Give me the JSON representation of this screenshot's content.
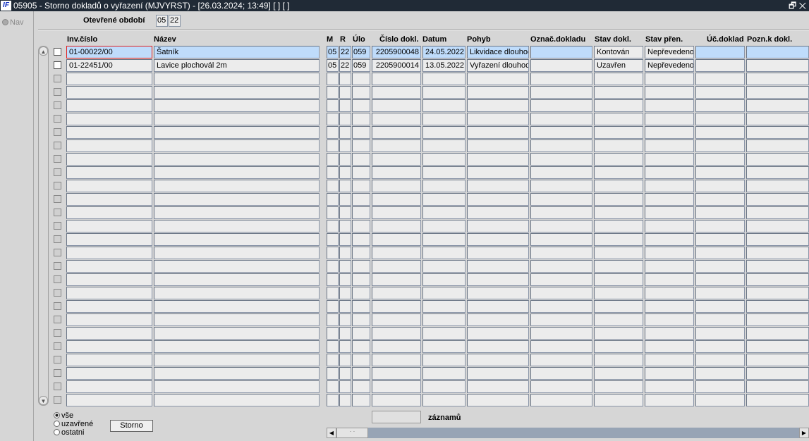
{
  "window": {
    "title": "05905 - Storno dokladů o vyřazení (MJVYRST) - [26.03.2024; 13:49]  [ ]  [ ]",
    "logo": "IF",
    "restore": "🗗",
    "close": "✕"
  },
  "sidebar": {
    "nav_label": "Nav"
  },
  "period": {
    "label": "Otevřené období",
    "month": "05",
    "year": "22"
  },
  "columns": [
    "Inv.číslo",
    "Název",
    "M",
    "R",
    "Úlo",
    "Číslo dokl.",
    "Datum",
    "Pohyb",
    "Označ.dokladu",
    "Stav dokl.",
    "Stav přen.",
    "Úč.doklad",
    "Pozn.k dokl."
  ],
  "rows": [
    [
      "01-00022/00",
      "Šatník",
      "05",
      "22",
      "059",
      "2205900048",
      "24.05.2022",
      "Likvidace dlouhod",
      "",
      "Kontován",
      "Nepřevedeno",
      "",
      ""
    ],
    [
      "01-22451/00",
      "Lavice plochovál 2m",
      "05",
      "22",
      "059",
      "2205900014",
      "13.05.2022",
      "Vyřazení dlouhod",
      "",
      "Uzavřen",
      "Nepřevedeno",
      "",
      ""
    ]
  ],
  "empty_rows": 25,
  "filter": {
    "options": [
      "vše",
      "uzavřené",
      "ostatni"
    ],
    "selected": "vše"
  },
  "storno_button": "Storno",
  "records": {
    "count": "",
    "label": "záznamů"
  }
}
